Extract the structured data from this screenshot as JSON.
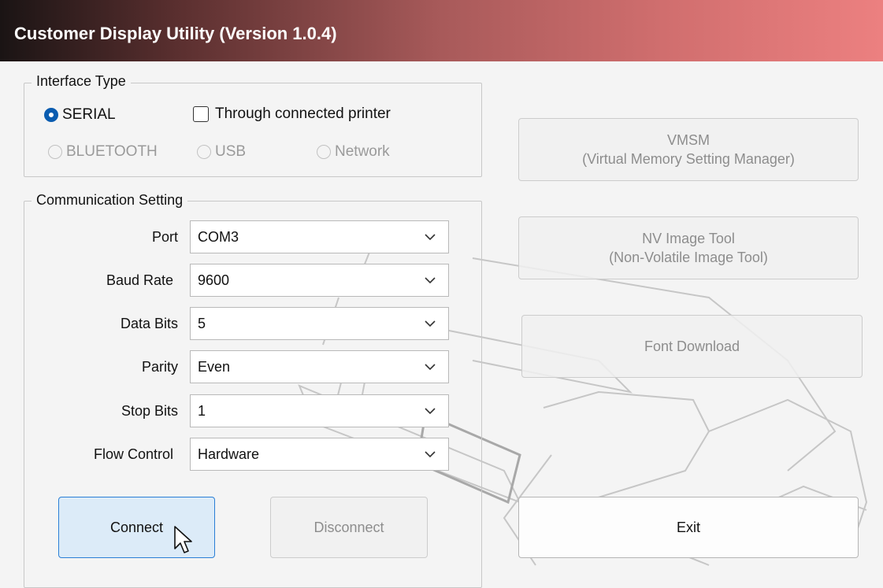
{
  "window": {
    "title": "Customer Display Utility (Version 1.0.4)"
  },
  "interface_type": {
    "label": "Interface Type",
    "serial": "SERIAL",
    "through_printer": "Through connected printer",
    "bluetooth": "BLUETOOTH",
    "usb": "USB",
    "network": "Network"
  },
  "communication": {
    "label": "Communication Setting",
    "fields": [
      {
        "label": "Port",
        "value": "COM3"
      },
      {
        "label": "Baud Rate",
        "value": "9600"
      },
      {
        "label": "Data Bits",
        "value": "5"
      },
      {
        "label": "Parity",
        "value": "Even"
      },
      {
        "label": "Stop Bits",
        "value": "1"
      },
      {
        "label": "Flow Control",
        "value": "Hardware"
      }
    ]
  },
  "tools": {
    "vmsm_line1": "VMSM",
    "vmsm_line2": "(Virtual Memory Setting Manager)",
    "nv_line1": "NV Image Tool",
    "nv_line2": "(Non-Volatile Image Tool)",
    "font_download": "Font Download"
  },
  "actions": {
    "connect": "Connect",
    "disconnect": "Disconnect",
    "exit": "Exit"
  },
  "colors": {
    "accent": "#0a5cb0",
    "focus_border": "#2a7fd6",
    "focus_fill": "#dcebf8"
  }
}
